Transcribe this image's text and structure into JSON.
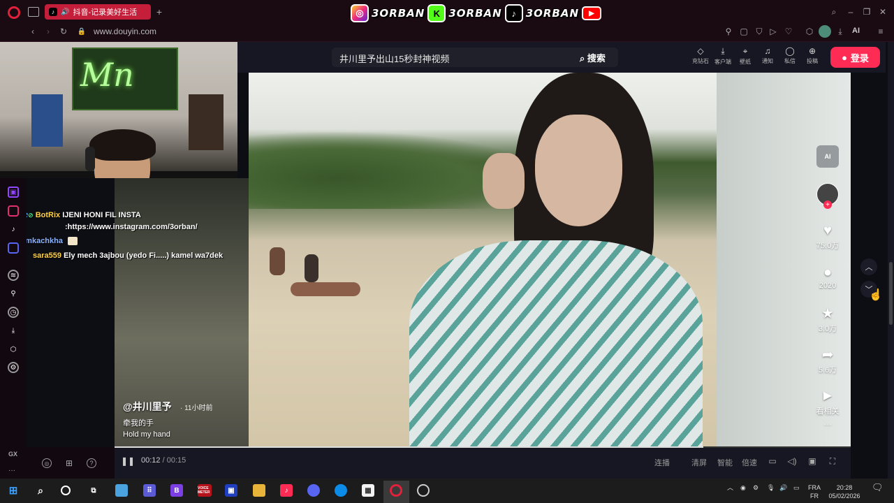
{
  "browser": {
    "tab_title": "抖音-记录美好生活",
    "url": "www.douyin.com",
    "ai_label": "AI",
    "gx_label": "GX"
  },
  "banner": {
    "instagram_name": "3ORBAN",
    "kick_name": "3ORBAN",
    "tiktok_name": "3ORBAN",
    "kick_letter": "K"
  },
  "webcam": {
    "neon_text": "Mn"
  },
  "chat": [
    {
      "user": "BotRix",
      "message": "IJENI HONI FIL INSTA",
      "user_color": "#ffd24a"
    },
    {
      "user": "",
      "message": ":https://www.instagram.com/3orban/",
      "user_color": "#ffffff"
    },
    {
      "user": "lemkachkha",
      "message": "",
      "user_color": "#8ab4ff"
    },
    {
      "user": "sara559",
      "message": "Ely mech 3ajbou (yedo Fi.....) kamel wa7dek",
      "user_color": "#ffd24a"
    }
  ],
  "douyin": {
    "search_query": "井川里予出山15秒封神视频",
    "search_button": "搜索",
    "header_items": [
      "充钻石",
      "客户端",
      "壁纸",
      "通知",
      "私信",
      "投稿"
    ],
    "login": "登录",
    "ai_badge": "AI"
  },
  "video": {
    "author": "@井川里予",
    "posted": "· 11小时前",
    "desc_line1": "牵我的手",
    "desc_line2": "Hold my hand"
  },
  "actions": {
    "likes": "75.0万",
    "comments": "2020",
    "favorites": "3.0万",
    "shares": "5.6万",
    "related": "看相关",
    "more": "···"
  },
  "player": {
    "current": "00:12",
    "separator": "/",
    "duration": "00:15",
    "items": [
      "连播",
      "清屏",
      "智能",
      "倍速"
    ]
  },
  "taskbar": {
    "lang_top": "FRA",
    "lang_bottom": "FR",
    "time": "20:28",
    "date": "05/02/2026",
    "voice_app": "VOICE METER"
  },
  "colors": {
    "accent": "#fe2c55",
    "opera": "#c41e3a",
    "douyin_bg": "#161722"
  }
}
